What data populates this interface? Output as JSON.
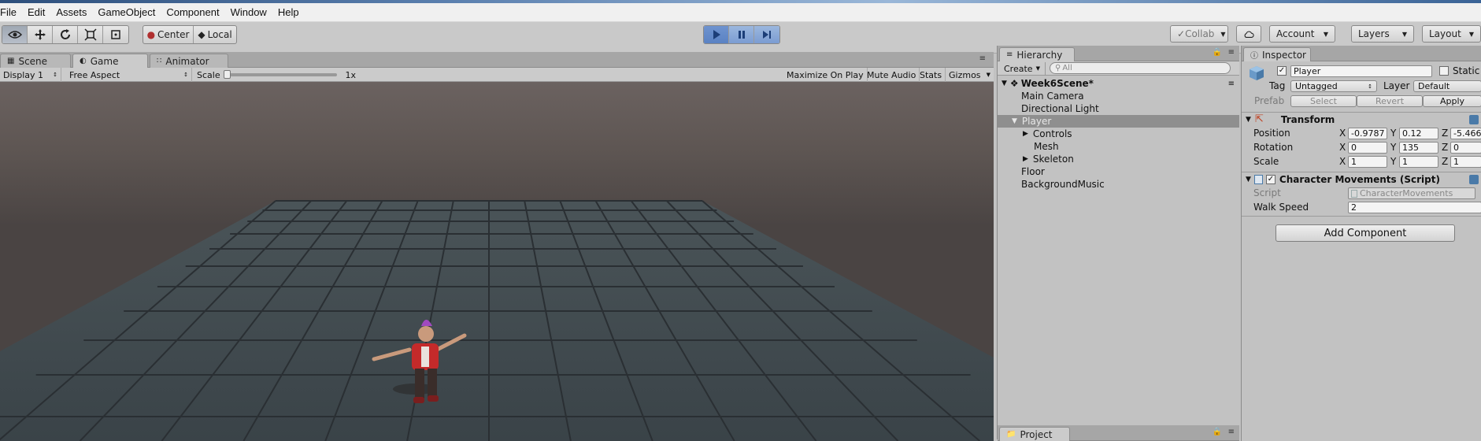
{
  "menu": [
    "File",
    "Edit",
    "Assets",
    "GameObject",
    "Component",
    "Window",
    "Help"
  ],
  "toolbar": {
    "pivot_mode": "Center",
    "pivot_rotation": "Local",
    "collab": "Collab",
    "account": "Account",
    "layers": "Layers",
    "layout": "Layout"
  },
  "game_tabs": [
    "Scene",
    "Game",
    "Animator"
  ],
  "game_bar": {
    "display": "Display 1",
    "aspect": "Free Aspect",
    "scale_label": "Scale",
    "scale_value": "1x",
    "maximize": "Maximize On Play",
    "mute": "Mute Audio",
    "stats": "Stats",
    "gizmos": "Gizmos"
  },
  "hierarchy": {
    "title": "Hierarchy",
    "create": "Create",
    "search_placeholder": "All",
    "scene_name": "Week6Scene*",
    "items": [
      {
        "label": "Main Camera",
        "level": 1
      },
      {
        "label": "Directional Light",
        "level": 1
      },
      {
        "label": "Player",
        "level": 1,
        "selected": true,
        "expanded": true
      },
      {
        "label": "Controls",
        "level": 2,
        "foldout": true
      },
      {
        "label": "Mesh",
        "level": 2
      },
      {
        "label": "Skeleton",
        "level": 2,
        "foldout": true
      },
      {
        "label": "Floor",
        "level": 1
      },
      {
        "label": "BackgroundMusic",
        "level": 1
      }
    ]
  },
  "project_tab": "Project",
  "inspector": {
    "title": "Inspector",
    "object_name": "Player",
    "static_label": "Static",
    "tag_label": "Tag",
    "tag_value": "Untagged",
    "layer_label": "Layer",
    "layer_value": "Default",
    "prefab_label": "Prefab",
    "prefab_select": "Select",
    "prefab_revert": "Revert",
    "prefab_apply": "Apply",
    "transform": {
      "title": "Transform",
      "position_label": "Position",
      "rotation_label": "Rotation",
      "scale_label": "Scale",
      "position": {
        "x": "-0.9787",
        "y": "0.12",
        "z": "-5.466"
      },
      "rotation": {
        "x": "0",
        "y": "135",
        "z": "0"
      },
      "scale": {
        "x": "1",
        "y": "1",
        "z": "1"
      }
    },
    "script_component": {
      "title": "Character Movements (Script)",
      "script_label": "Script",
      "script_value": "CharacterMovements",
      "walk_speed_label": "Walk Speed",
      "walk_speed_value": "2"
    },
    "add_component": "Add Component"
  },
  "colors": {
    "play_active": "#5a82c3",
    "selection": "#8f8f8f",
    "panel_bg": "#c2c2c2",
    "sky": "#6b6260"
  }
}
